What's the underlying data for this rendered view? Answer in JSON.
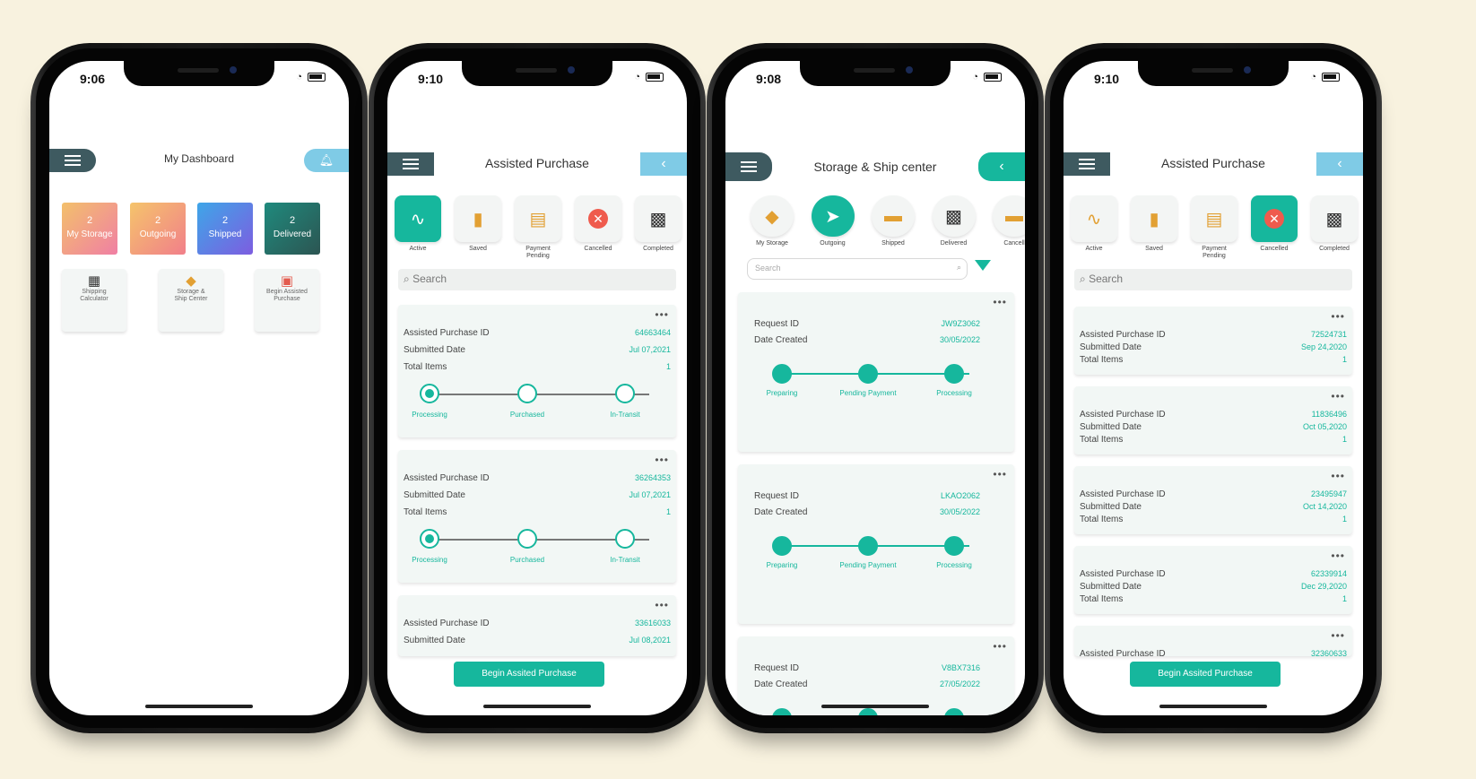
{
  "phone1": {
    "time": "9:06",
    "title": "My Dashboard",
    "tiles": [
      {
        "count": "2",
        "label": "My Storage",
        "color": "#f5a27a"
      },
      {
        "count": "2",
        "label": "Outgoing",
        "color": "#f7b26b"
      },
      {
        "count": "2",
        "label": "Shipped",
        "color": "#5b7de6"
      },
      {
        "count": "2",
        "label": "Delivered",
        "color": "#1f6a64"
      }
    ],
    "services": [
      {
        "line1": "Shipping",
        "line2": "Calculator"
      },
      {
        "line1": "Storage &",
        "line2": "Ship Center"
      },
      {
        "line1": "Begin Assisted",
        "line2": "Purchase"
      }
    ]
  },
  "phone2": {
    "time": "9:10",
    "title": "Assisted Purchase",
    "back": "‹",
    "tabs": [
      {
        "label": "Active"
      },
      {
        "label": "Saved"
      },
      {
        "label1": "Payment",
        "label2": "Pending"
      },
      {
        "label": "Cancelled"
      },
      {
        "label": "Completed"
      }
    ],
    "search_placeholder": "Search",
    "cards": [
      {
        "id_label": "Assisted Purchase ID",
        "id": "64663464",
        "date_label": "Submitted Date",
        "date": "Jul 07,2021",
        "items_label": "Total Items",
        "items": "1"
      },
      {
        "id_label": "Assisted Purchase ID",
        "id": "36264353",
        "date_label": "Submitted Date",
        "date": "Jul 07,2021",
        "items_label": "Total Items",
        "items": "1"
      },
      {
        "id_label": "Assisted Purchase ID",
        "id": "33616033",
        "date_label": "Submitted Date",
        "date": "Jul 08,2021"
      }
    ],
    "steps": [
      "Processing",
      "Purchased",
      "In-Transit"
    ],
    "cta": "Begin Assited Purchase"
  },
  "phone3": {
    "time": "9:08",
    "title": "Storage & Ship center",
    "back": "‹",
    "tabs": [
      "My Storage",
      "Outgoing",
      "Shipped",
      "Delivered",
      "Cancell"
    ],
    "search_placeholder": "Search",
    "cards": [
      {
        "id_label": "Request ID",
        "id": "JW9Z3062",
        "date_label": "Date Created",
        "date": "30/05/2022"
      },
      {
        "id_label": "Request ID",
        "id": "LKAO2062",
        "date_label": "Date Created",
        "date": "30/05/2022"
      },
      {
        "id_label": "Request ID",
        "id": "V8BX7316",
        "date_label": "Date Created",
        "date": "27/05/2022"
      }
    ],
    "steps": [
      "Preparing",
      "Pending Payment",
      "Processing"
    ]
  },
  "phone4": {
    "time": "9:10",
    "title": "Assisted Purchase",
    "back": "‹",
    "tabs": [
      {
        "label": "Active"
      },
      {
        "label": "Saved"
      },
      {
        "label1": "Payment",
        "label2": "Pending"
      },
      {
        "label": "Cancelled"
      },
      {
        "label": "Completed"
      }
    ],
    "search_placeholder": "Search",
    "cards": [
      {
        "id_label": "Assisted Purchase ID",
        "id": "72524731",
        "date_label": "Submitted Date",
        "date": "Sep 24,2020",
        "items_label": "Total Items",
        "items": "1"
      },
      {
        "id_label": "Assisted Purchase ID",
        "id": "11836496",
        "date_label": "Submitted Date",
        "date": "Oct 05,2020",
        "items_label": "Total Items",
        "items": "1"
      },
      {
        "id_label": "Assisted Purchase ID",
        "id": "23495947",
        "date_label": "Submitted Date",
        "date": "Oct 14,2020",
        "items_label": "Total Items",
        "items": "1"
      },
      {
        "id_label": "Assisted Purchase ID",
        "id": "62339914",
        "date_label": "Submitted Date",
        "date": "Dec 29,2020",
        "items_label": "Total Items",
        "items": "1"
      },
      {
        "id_label": "Assisted Purchase ID",
        "id": "32360633"
      }
    ],
    "cta": "Begin Assited Purchase"
  }
}
